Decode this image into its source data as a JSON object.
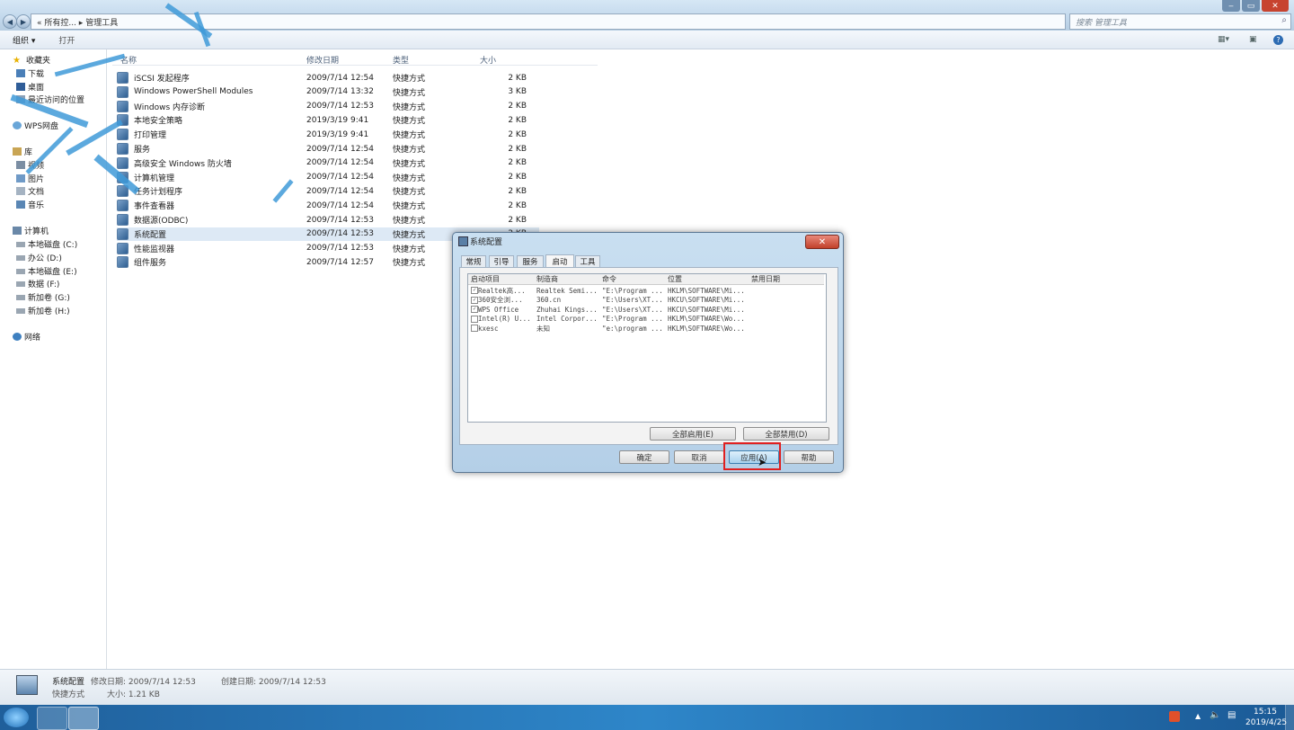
{
  "window": {
    "address": "« 所有控... ▸ 管理工具",
    "search_placeholder": "搜索 管理工具",
    "min": "‒",
    "max": "▭",
    "close": "✕"
  },
  "toolbar": {
    "organize": "组织 ▾",
    "open": "打开"
  },
  "sidebar": {
    "favorites": "收藏夹",
    "items_fav": [
      "下载",
      "桌面",
      "最近访问的位置"
    ],
    "wps": "WPS网盘",
    "library": "库",
    "items_lib": [
      "视频",
      "图片",
      "文档",
      "音乐"
    ],
    "computer": "计算机",
    "items_comp": [
      "本地磁盘 (C:)",
      "办公 (D:)",
      "本地磁盘 (E:)",
      "数据 (F:)",
      "新加卷 (G:)",
      "新加卷 (H:)"
    ],
    "network": "网络"
  },
  "columns": {
    "name": "名称",
    "date": "修改日期",
    "type": "类型",
    "size": "大小"
  },
  "files": [
    {
      "name": "iSCSI 发起程序",
      "date": "2009/7/14 12:54",
      "type": "快捷方式",
      "size": "2 KB"
    },
    {
      "name": "Windows PowerShell Modules",
      "date": "2009/7/14 13:32",
      "type": "快捷方式",
      "size": "3 KB"
    },
    {
      "name": "Windows 内存诊断",
      "date": "2009/7/14 12:53",
      "type": "快捷方式",
      "size": "2 KB"
    },
    {
      "name": "本地安全策略",
      "date": "2019/3/19 9:41",
      "type": "快捷方式",
      "size": "2 KB"
    },
    {
      "name": "打印管理",
      "date": "2019/3/19 9:41",
      "type": "快捷方式",
      "size": "2 KB"
    },
    {
      "name": "服务",
      "date": "2009/7/14 12:54",
      "type": "快捷方式",
      "size": "2 KB"
    },
    {
      "name": "高级安全 Windows 防火墙",
      "date": "2009/7/14 12:54",
      "type": "快捷方式",
      "size": "2 KB"
    },
    {
      "name": "计算机管理",
      "date": "2009/7/14 12:54",
      "type": "快捷方式",
      "size": "2 KB"
    },
    {
      "name": "任务计划程序",
      "date": "2009/7/14 12:54",
      "type": "快捷方式",
      "size": "2 KB"
    },
    {
      "name": "事件查看器",
      "date": "2009/7/14 12:54",
      "type": "快捷方式",
      "size": "2 KB"
    },
    {
      "name": "数据源(ODBC)",
      "date": "2009/7/14 12:53",
      "type": "快捷方式",
      "size": "2 KB"
    },
    {
      "name": "系统配置",
      "date": "2009/7/14 12:53",
      "type": "快捷方式",
      "size": "2 KB"
    },
    {
      "name": "性能监视器",
      "date": "2009/7/14 12:53",
      "type": "快捷方式",
      "size": "2 KB"
    },
    {
      "name": "组件服务",
      "date": "2009/7/14 12:57",
      "type": "快捷方式",
      "size": "2 KB"
    }
  ],
  "status": {
    "name": "系统配置",
    "modified": "修改日期: 2009/7/14 12:53",
    "created": "创建日期: 2009/7/14 12:53",
    "type": "快捷方式",
    "size": "大小: 1.21 KB"
  },
  "dialog": {
    "title": "系统配置",
    "tabs": [
      "常规",
      "引导",
      "服务",
      "启动",
      "工具"
    ],
    "active_tab": "启动",
    "headers": [
      "启动项目",
      "制造商",
      "命令",
      "位置",
      "禁用日期"
    ],
    "rows": [
      {
        "checked": true,
        "item": "Realtek高...",
        "maker": "Realtek Semi...",
        "cmd": "\"E:\\Program ...",
        "loc": "HKLM\\SOFTWARE\\Mi...",
        "date": ""
      },
      {
        "checked": true,
        "item": "360安全浏...",
        "maker": "360.cn",
        "cmd": "\"E:\\Users\\XT...",
        "loc": "HKCU\\SOFTWARE\\Mi...",
        "date": ""
      },
      {
        "checked": true,
        "item": "WPS Office",
        "maker": "Zhuhai Kings...",
        "cmd": "\"E:\\Users\\XT...",
        "loc": "HKCU\\SOFTWARE\\Mi...",
        "date": ""
      },
      {
        "checked": false,
        "item": "Intel(R) U...",
        "maker": "Intel Corpor...",
        "cmd": "\"E:\\Program ...",
        "loc": "HKLM\\SOFTWARE\\Wo...",
        "date": ""
      },
      {
        "checked": false,
        "item": "kxesc",
        "maker": "未知",
        "cmd": "\"e:\\program ...",
        "loc": "HKLM\\SOFTWARE\\Wo...",
        "date": ""
      }
    ],
    "enable_all": "全部启用(E)",
    "disable_all": "全部禁用(D)",
    "ok": "确定",
    "cancel": "取消",
    "apply": "应用(A)",
    "help": "帮助"
  },
  "taskbar": {
    "time": "15:15",
    "date": "2019/4/25"
  },
  "colors": {
    "accent": "#3f9ad8",
    "highlight": "#e02020"
  }
}
